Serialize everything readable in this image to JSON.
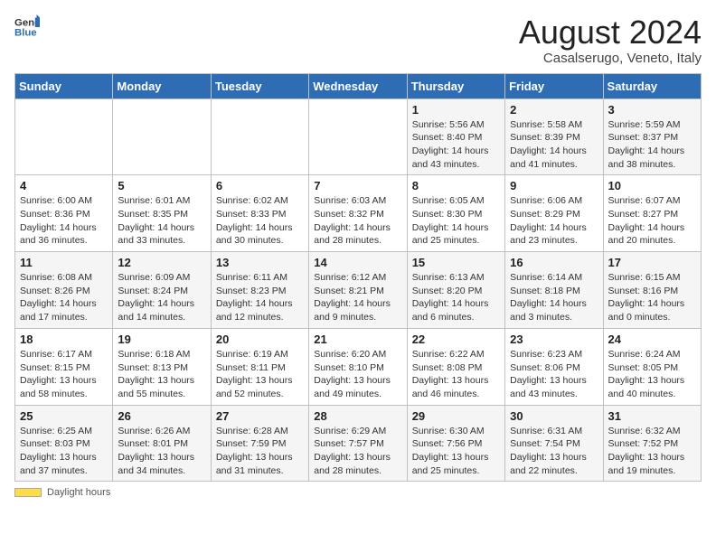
{
  "header": {
    "logo_general": "General",
    "logo_blue": "Blue",
    "title": "August 2024",
    "subtitle": "Casalserugo, Veneto, Italy"
  },
  "days_of_week": [
    "Sunday",
    "Monday",
    "Tuesday",
    "Wednesday",
    "Thursday",
    "Friday",
    "Saturday"
  ],
  "weeks": [
    [
      {
        "day": "",
        "text": ""
      },
      {
        "day": "",
        "text": ""
      },
      {
        "day": "",
        "text": ""
      },
      {
        "day": "",
        "text": ""
      },
      {
        "day": "1",
        "text": "Sunrise: 5:56 AM\nSunset: 8:40 PM\nDaylight: 14 hours and 43 minutes."
      },
      {
        "day": "2",
        "text": "Sunrise: 5:58 AM\nSunset: 8:39 PM\nDaylight: 14 hours and 41 minutes."
      },
      {
        "day": "3",
        "text": "Sunrise: 5:59 AM\nSunset: 8:37 PM\nDaylight: 14 hours and 38 minutes."
      }
    ],
    [
      {
        "day": "4",
        "text": "Sunrise: 6:00 AM\nSunset: 8:36 PM\nDaylight: 14 hours and 36 minutes."
      },
      {
        "day": "5",
        "text": "Sunrise: 6:01 AM\nSunset: 8:35 PM\nDaylight: 14 hours and 33 minutes."
      },
      {
        "day": "6",
        "text": "Sunrise: 6:02 AM\nSunset: 8:33 PM\nDaylight: 14 hours and 30 minutes."
      },
      {
        "day": "7",
        "text": "Sunrise: 6:03 AM\nSunset: 8:32 PM\nDaylight: 14 hours and 28 minutes."
      },
      {
        "day": "8",
        "text": "Sunrise: 6:05 AM\nSunset: 8:30 PM\nDaylight: 14 hours and 25 minutes."
      },
      {
        "day": "9",
        "text": "Sunrise: 6:06 AM\nSunset: 8:29 PM\nDaylight: 14 hours and 23 minutes."
      },
      {
        "day": "10",
        "text": "Sunrise: 6:07 AM\nSunset: 8:27 PM\nDaylight: 14 hours and 20 minutes."
      }
    ],
    [
      {
        "day": "11",
        "text": "Sunrise: 6:08 AM\nSunset: 8:26 PM\nDaylight: 14 hours and 17 minutes."
      },
      {
        "day": "12",
        "text": "Sunrise: 6:09 AM\nSunset: 8:24 PM\nDaylight: 14 hours and 14 minutes."
      },
      {
        "day": "13",
        "text": "Sunrise: 6:11 AM\nSunset: 8:23 PM\nDaylight: 14 hours and 12 minutes."
      },
      {
        "day": "14",
        "text": "Sunrise: 6:12 AM\nSunset: 8:21 PM\nDaylight: 14 hours and 9 minutes."
      },
      {
        "day": "15",
        "text": "Sunrise: 6:13 AM\nSunset: 8:20 PM\nDaylight: 14 hours and 6 minutes."
      },
      {
        "day": "16",
        "text": "Sunrise: 6:14 AM\nSunset: 8:18 PM\nDaylight: 14 hours and 3 minutes."
      },
      {
        "day": "17",
        "text": "Sunrise: 6:15 AM\nSunset: 8:16 PM\nDaylight: 14 hours and 0 minutes."
      }
    ],
    [
      {
        "day": "18",
        "text": "Sunrise: 6:17 AM\nSunset: 8:15 PM\nDaylight: 13 hours and 58 minutes."
      },
      {
        "day": "19",
        "text": "Sunrise: 6:18 AM\nSunset: 8:13 PM\nDaylight: 13 hours and 55 minutes."
      },
      {
        "day": "20",
        "text": "Sunrise: 6:19 AM\nSunset: 8:11 PM\nDaylight: 13 hours and 52 minutes."
      },
      {
        "day": "21",
        "text": "Sunrise: 6:20 AM\nSunset: 8:10 PM\nDaylight: 13 hours and 49 minutes."
      },
      {
        "day": "22",
        "text": "Sunrise: 6:22 AM\nSunset: 8:08 PM\nDaylight: 13 hours and 46 minutes."
      },
      {
        "day": "23",
        "text": "Sunrise: 6:23 AM\nSunset: 8:06 PM\nDaylight: 13 hours and 43 minutes."
      },
      {
        "day": "24",
        "text": "Sunrise: 6:24 AM\nSunset: 8:05 PM\nDaylight: 13 hours and 40 minutes."
      }
    ],
    [
      {
        "day": "25",
        "text": "Sunrise: 6:25 AM\nSunset: 8:03 PM\nDaylight: 13 hours and 37 minutes."
      },
      {
        "day": "26",
        "text": "Sunrise: 6:26 AM\nSunset: 8:01 PM\nDaylight: 13 hours and 34 minutes."
      },
      {
        "day": "27",
        "text": "Sunrise: 6:28 AM\nSunset: 7:59 PM\nDaylight: 13 hours and 31 minutes."
      },
      {
        "day": "28",
        "text": "Sunrise: 6:29 AM\nSunset: 7:57 PM\nDaylight: 13 hours and 28 minutes."
      },
      {
        "day": "29",
        "text": "Sunrise: 6:30 AM\nSunset: 7:56 PM\nDaylight: 13 hours and 25 minutes."
      },
      {
        "day": "30",
        "text": "Sunrise: 6:31 AM\nSunset: 7:54 PM\nDaylight: 13 hours and 22 minutes."
      },
      {
        "day": "31",
        "text": "Sunrise: 6:32 AM\nSunset: 7:52 PM\nDaylight: 13 hours and 19 minutes."
      }
    ]
  ],
  "footer": {
    "label": "Daylight hours"
  }
}
